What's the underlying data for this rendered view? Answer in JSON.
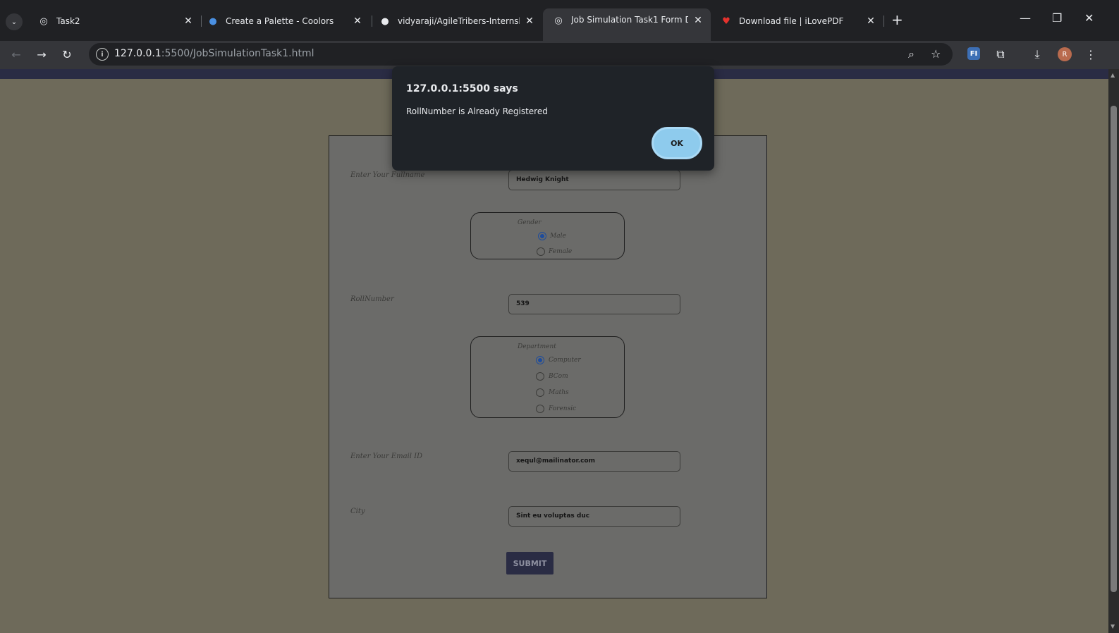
{
  "tabs": [
    {
      "title": "Task2",
      "favicon": "globe-icon"
    },
    {
      "title": "Create a Palette - Coolors",
      "favicon": "coolors-icon"
    },
    {
      "title": "vidyaraji/AgileTribers-Internship",
      "favicon": "github-icon"
    },
    {
      "title": "Job Simulation Task1 Form Data",
      "favicon": "globe-icon"
    },
    {
      "title": "Download file | iLovePDF",
      "favicon": "heart-icon"
    }
  ],
  "address_bar": {
    "host": "127.0.0.1",
    "rest": ":5500/JobSimulationTask1.html"
  },
  "profile_initial": "R",
  "ext_badge": "FI",
  "dialog": {
    "origin": "127.0.0.1:5500 says",
    "message": "RollNumber is Already Registered",
    "ok_label": "OK"
  },
  "form": {
    "fullname_label": "Enter Your Fullname",
    "fullname_value": "Hedwig Knight",
    "gender_legend": "Gender",
    "gender_options": [
      "Male",
      "Female"
    ],
    "gender_selected": "Male",
    "roll_label": "RollNumber",
    "roll_value": "539",
    "dept_legend": "Department",
    "dept_options": [
      "Computer",
      "BCom",
      "Maths",
      "Forensic"
    ],
    "dept_selected": "Computer",
    "email_label": "Enter Your Email ID",
    "email_value": "xequl@mailinator.com",
    "city_label": "City",
    "city_value": "Sint eu voluptas duc",
    "submit_label": "SUBMIT"
  },
  "colors": {
    "page_background": "#7b7563",
    "nav_strip": "#2a2c44",
    "ok_button": "#8ecbed",
    "dialog_bg": "#1f2328"
  }
}
